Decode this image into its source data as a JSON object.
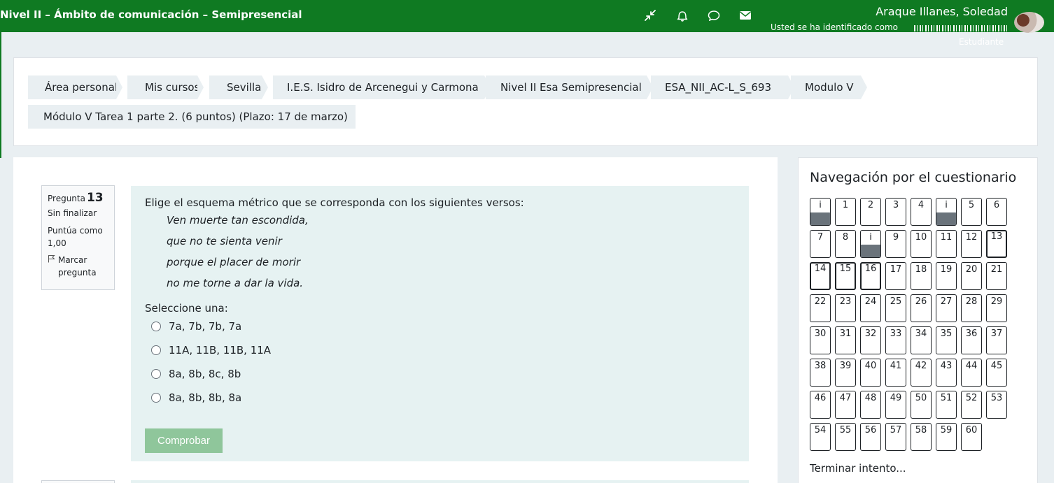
{
  "header": {
    "course_title": "Nivel II – Ámbito de comunicación – Semipresencial",
    "user_name": "Araque Illanes, Soledad",
    "logged_in_as": "Usted se ha identificado como",
    "role": "Estudiante",
    "icons": [
      "compress-icon",
      "bell-icon",
      "chat-bubble-icon",
      "envelope-icon"
    ]
  },
  "breadcrumb": {
    "items": [
      "Área personal",
      "Mis cursos",
      "Sevilla",
      "I.E.S. Isidro de Arcenegui y Carmona",
      "Nivel II Esa Semipresencial",
      "ESA_NII_AC-L_S_693",
      "Modulo V",
      "Módulo V Tarea 1 parte 2. (6 puntos) (Plazo: 17 de marzo)"
    ]
  },
  "question": {
    "label": "Pregunta",
    "number": "13",
    "state": "Sin finalizar",
    "grade": "Puntúa como 1,00",
    "flag_label": "Marcar pregunta",
    "text": "Elige el esquema métrico que se corresponda con los siguientes versos:",
    "verses": [
      "Ven muerte tan escondida,",
      "que no te sienta venir",
      "porque el placer de morir",
      "no me torne a dar la vida."
    ],
    "prompt": "Seleccione una:",
    "options": [
      "7a, 7b, 7b, 7a",
      "11A, 11B, 11B, 11A",
      "8a, 8b, 8c, 8b",
      "8a, 8b, 8b, 8a"
    ],
    "check_button": "Comprobar"
  },
  "quiz_nav": {
    "title": "Navegación por el cuestionario",
    "buttons": [
      {
        "label": "i",
        "info": true
      },
      {
        "label": "1"
      },
      {
        "label": "2"
      },
      {
        "label": "3"
      },
      {
        "label": "4"
      },
      {
        "label": "i",
        "info": true
      },
      {
        "label": "5"
      },
      {
        "label": "6"
      },
      {
        "label": "7"
      },
      {
        "label": "8"
      },
      {
        "label": "i",
        "info": true
      },
      {
        "label": "9"
      },
      {
        "label": "10"
      },
      {
        "label": "11"
      },
      {
        "label": "12"
      },
      {
        "label": "13",
        "current": true
      },
      {
        "label": "14",
        "current": true
      },
      {
        "label": "15",
        "current": true
      },
      {
        "label": "16",
        "current": true
      },
      {
        "label": "17"
      },
      {
        "label": "18"
      },
      {
        "label": "19"
      },
      {
        "label": "20"
      },
      {
        "label": "21"
      },
      {
        "label": "22"
      },
      {
        "label": "23"
      },
      {
        "label": "24"
      },
      {
        "label": "25"
      },
      {
        "label": "26"
      },
      {
        "label": "27"
      },
      {
        "label": "28"
      },
      {
        "label": "29"
      },
      {
        "label": "30"
      },
      {
        "label": "31"
      },
      {
        "label": "32"
      },
      {
        "label": "33"
      },
      {
        "label": "34"
      },
      {
        "label": "35"
      },
      {
        "label": "36"
      },
      {
        "label": "37"
      },
      {
        "label": "38"
      },
      {
        "label": "39"
      },
      {
        "label": "40"
      },
      {
        "label": "41"
      },
      {
        "label": "42"
      },
      {
        "label": "43"
      },
      {
        "label": "44"
      },
      {
        "label": "45"
      },
      {
        "label": "46"
      },
      {
        "label": "47"
      },
      {
        "label": "48"
      },
      {
        "label": "49"
      },
      {
        "label": "50"
      },
      {
        "label": "51"
      },
      {
        "label": "52"
      },
      {
        "label": "53"
      },
      {
        "label": "54"
      },
      {
        "label": "55"
      },
      {
        "label": "56"
      },
      {
        "label": "57"
      },
      {
        "label": "58"
      },
      {
        "label": "59"
      },
      {
        "label": "60"
      }
    ],
    "finish_link": "Terminar intento..."
  },
  "colors": {
    "navbar": "#0f7a22",
    "question_bg": "#e6f2f2",
    "check_button": "#8fc69b",
    "info_fill": "#6a737b"
  }
}
